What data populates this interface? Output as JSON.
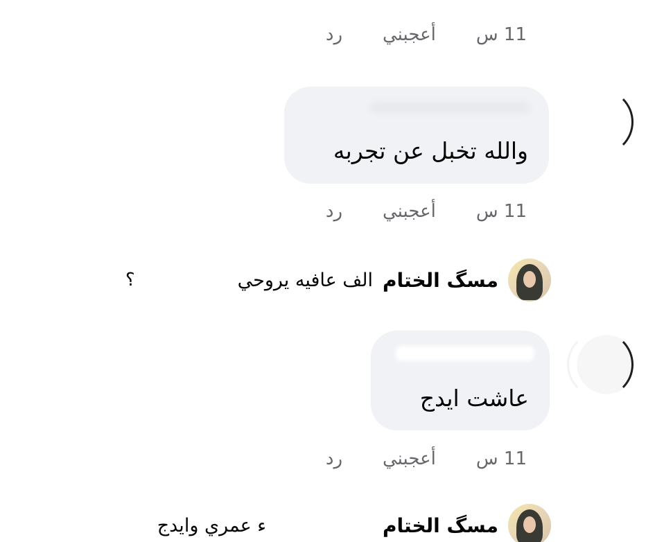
{
  "comment_actions": [
    {
      "time": "11 س",
      "like": "أعجبني",
      "reply": "رد"
    },
    {
      "time": "11 س",
      "like": "أعجبني",
      "reply": "رد"
    },
    {
      "time": "11 س",
      "like": "أعجبني",
      "reply": "رد"
    }
  ],
  "comments": [
    {
      "text": "والله تخبل عن تجربه"
    },
    {
      "text": "عاشت ايدج"
    }
  ],
  "replies": [
    {
      "name": "مسگ الختام",
      "text": "الف عافيه يروحي",
      "tail": "؟"
    },
    {
      "name": "مسگ الختام",
      "text": "ء عمري وايدج"
    }
  ],
  "colors": {
    "bubble": "#f0f2f5",
    "meta": "#65676b",
    "text": "#050505"
  },
  "icons": {
    "avatar": "profile-avatar-icon"
  }
}
